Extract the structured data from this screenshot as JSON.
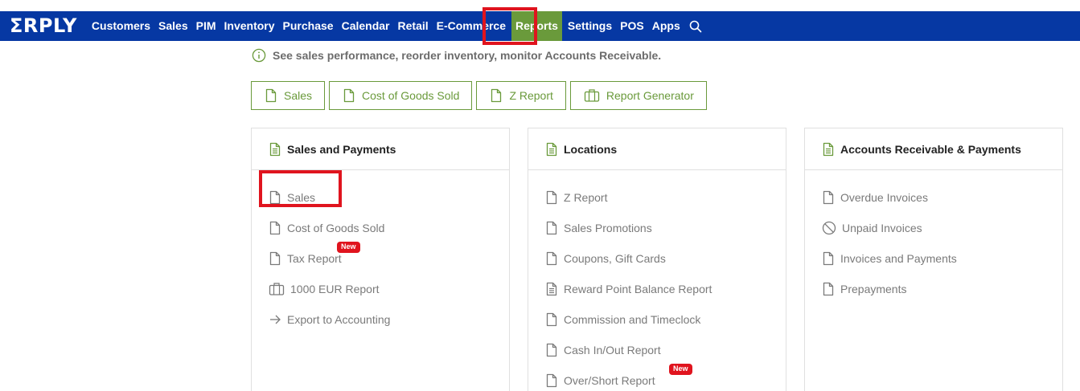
{
  "brand": {
    "logo_text": "ΣRPLY"
  },
  "nav": {
    "items": [
      {
        "label": "Customers",
        "name": "nav-customers"
      },
      {
        "label": "Sales",
        "name": "nav-sales"
      },
      {
        "label": "PIM",
        "name": "nav-pim"
      },
      {
        "label": "Inventory",
        "name": "nav-inventory"
      },
      {
        "label": "Purchase",
        "name": "nav-purchase"
      },
      {
        "label": "Calendar",
        "name": "nav-calendar"
      },
      {
        "label": "Retail",
        "name": "nav-retail"
      },
      {
        "label": "E-Commerce",
        "name": "nav-e-commerce"
      },
      {
        "label": "Reports",
        "name": "nav-reports",
        "active": true
      },
      {
        "label": "Settings",
        "name": "nav-settings"
      },
      {
        "label": "POS",
        "name": "nav-pos"
      },
      {
        "label": "Apps",
        "name": "nav-apps"
      }
    ],
    "search_icon": "search-icon"
  },
  "info": {
    "icon": "info-icon",
    "text": "See sales performance, reorder inventory, monitor Accounts Receivable."
  },
  "quick_buttons": [
    {
      "label": "Sales",
      "icon": "document-icon"
    },
    {
      "label": "Cost of Goods Sold",
      "icon": "document-icon"
    },
    {
      "label": "Z Report",
      "icon": "document-icon"
    },
    {
      "label": "Report Generator",
      "icon": "briefcase-icon"
    }
  ],
  "cards": [
    {
      "title": "Sales and Payments",
      "icon": "document-lines-icon",
      "items": [
        {
          "label": "Sales",
          "icon": "document-icon"
        },
        {
          "label": "Cost of Goods Sold",
          "icon": "document-icon"
        },
        {
          "label": "Tax Report",
          "icon": "document-icon",
          "badge": "New"
        },
        {
          "label": "1000 EUR Report",
          "icon": "briefcase-icon"
        },
        {
          "label": "Export to Accounting",
          "icon": "arrow-right-icon"
        }
      ]
    },
    {
      "title": "Locations",
      "icon": "document-lines-icon",
      "items": [
        {
          "label": "Z Report",
          "icon": "document-icon"
        },
        {
          "label": "Sales Promotions",
          "icon": "document-icon"
        },
        {
          "label": "Coupons, Gift Cards",
          "icon": "document-icon"
        },
        {
          "label": "Reward Point Balance Report",
          "icon": "document-lines-icon"
        },
        {
          "label": "Commission and Timeclock",
          "icon": "document-icon"
        },
        {
          "label": "Cash In/Out Report",
          "icon": "document-icon"
        },
        {
          "label": "Over/Short Report",
          "icon": "document-icon",
          "badge": "New"
        }
      ]
    },
    {
      "title": "Accounts Receivable & Payments",
      "icon": "document-lines-icon",
      "items": [
        {
          "label": "Overdue Invoices",
          "icon": "document-icon"
        },
        {
          "label": "Unpaid Invoices",
          "icon": "ban-icon"
        },
        {
          "label": "Invoices and Payments",
          "icon": "document-icon"
        },
        {
          "label": "Prepayments",
          "icon": "document-icon"
        }
      ]
    }
  ],
  "colors": {
    "topbar": "#0638a3",
    "accent_green": "#6a9a3b",
    "highlight_red": "#e0141e",
    "text_gray": "#7a7a7a"
  }
}
